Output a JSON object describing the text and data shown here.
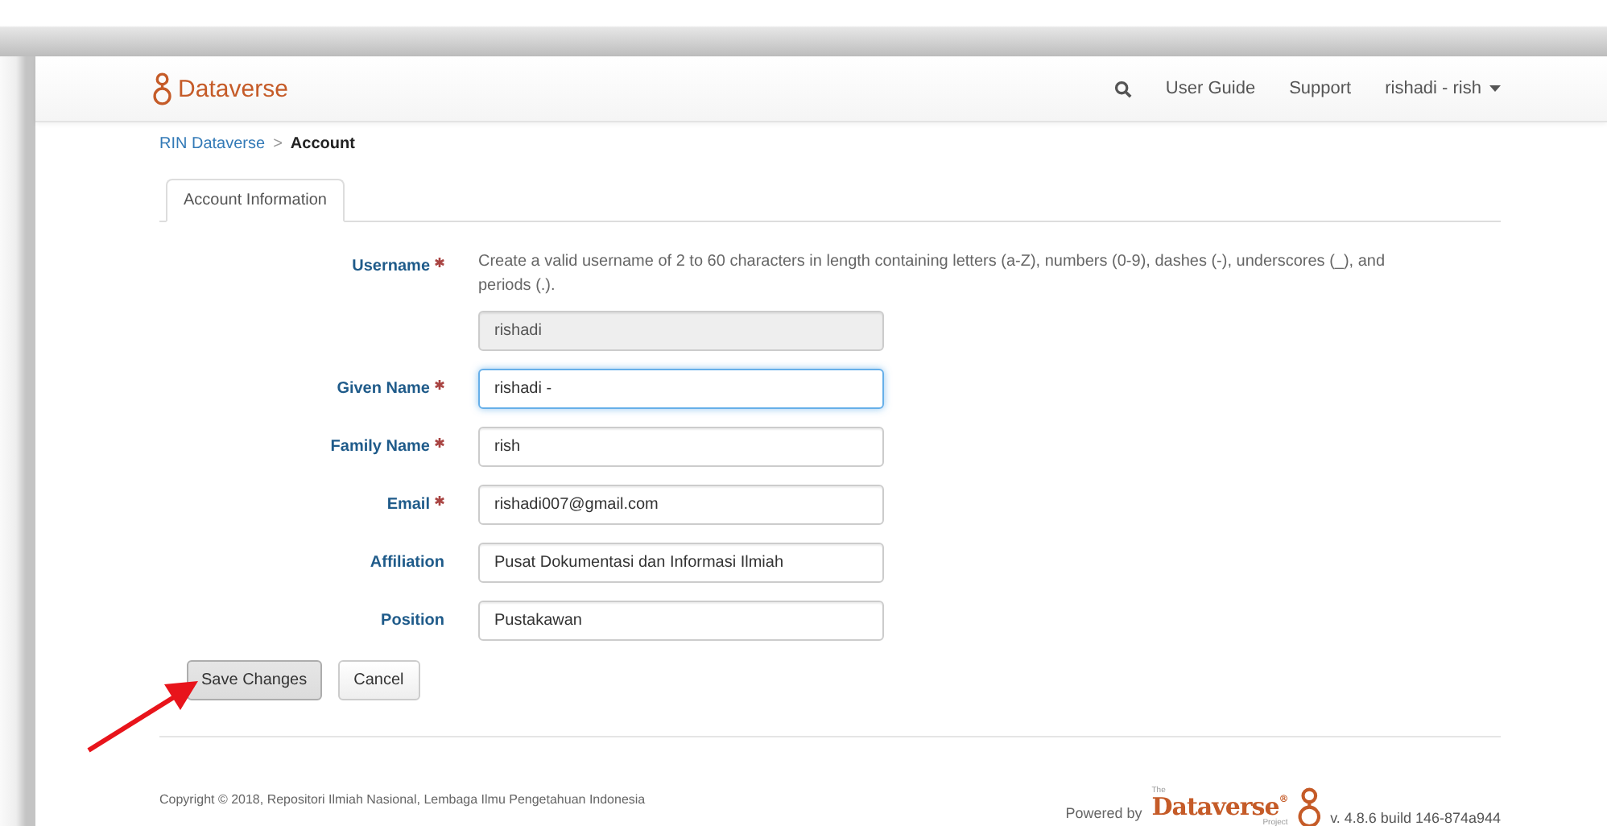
{
  "navbar": {
    "brand": "Dataverse",
    "links": [
      "User Guide",
      "Support"
    ],
    "user_menu": "rishadi - rish"
  },
  "breadcrumb": {
    "parent": "RIN Dataverse",
    "separator": ">",
    "current": "Account"
  },
  "tabs": [
    {
      "label": "Account Information",
      "selected": true
    }
  ],
  "fields": [
    {
      "label": "Username",
      "required": true,
      "help": "Create a valid username of 2 to 60 characters in length containing letters (a-Z), numbers (0-9), dashes (-), underscores (_), and periods (.).",
      "value": "rishadi",
      "disabled": true,
      "focused": false
    },
    {
      "label": "Given Name",
      "required": true,
      "value": "rishadi -",
      "disabled": false,
      "focused": true
    },
    {
      "label": "Family Name",
      "required": true,
      "value": "rish",
      "disabled": false,
      "focused": false
    },
    {
      "label": "Email",
      "required": true,
      "value": "rishadi007@gmail.com",
      "disabled": false,
      "focused": false
    },
    {
      "label": "Affiliation",
      "required": false,
      "value": "Pusat Dokumentasi dan Informasi Ilmiah",
      "disabled": false,
      "focused": false
    },
    {
      "label": "Position",
      "required": false,
      "value": "Pustakawan",
      "disabled": false,
      "focused": false
    }
  ],
  "buttons": [
    "Save Changes",
    "Cancel"
  ],
  "footer": {
    "copyright": "Copyright © 2018, Repositori Ilmiah Nasional, Lembaga Ilmu Pengetahuan Indonesia",
    "powered_by": "Powered by",
    "logo_small": "The",
    "logo_name": "Dataverse",
    "logo_mark": "®",
    "logo_sub": "Project",
    "version": "v. 4.8.6 build 146-874a944"
  }
}
